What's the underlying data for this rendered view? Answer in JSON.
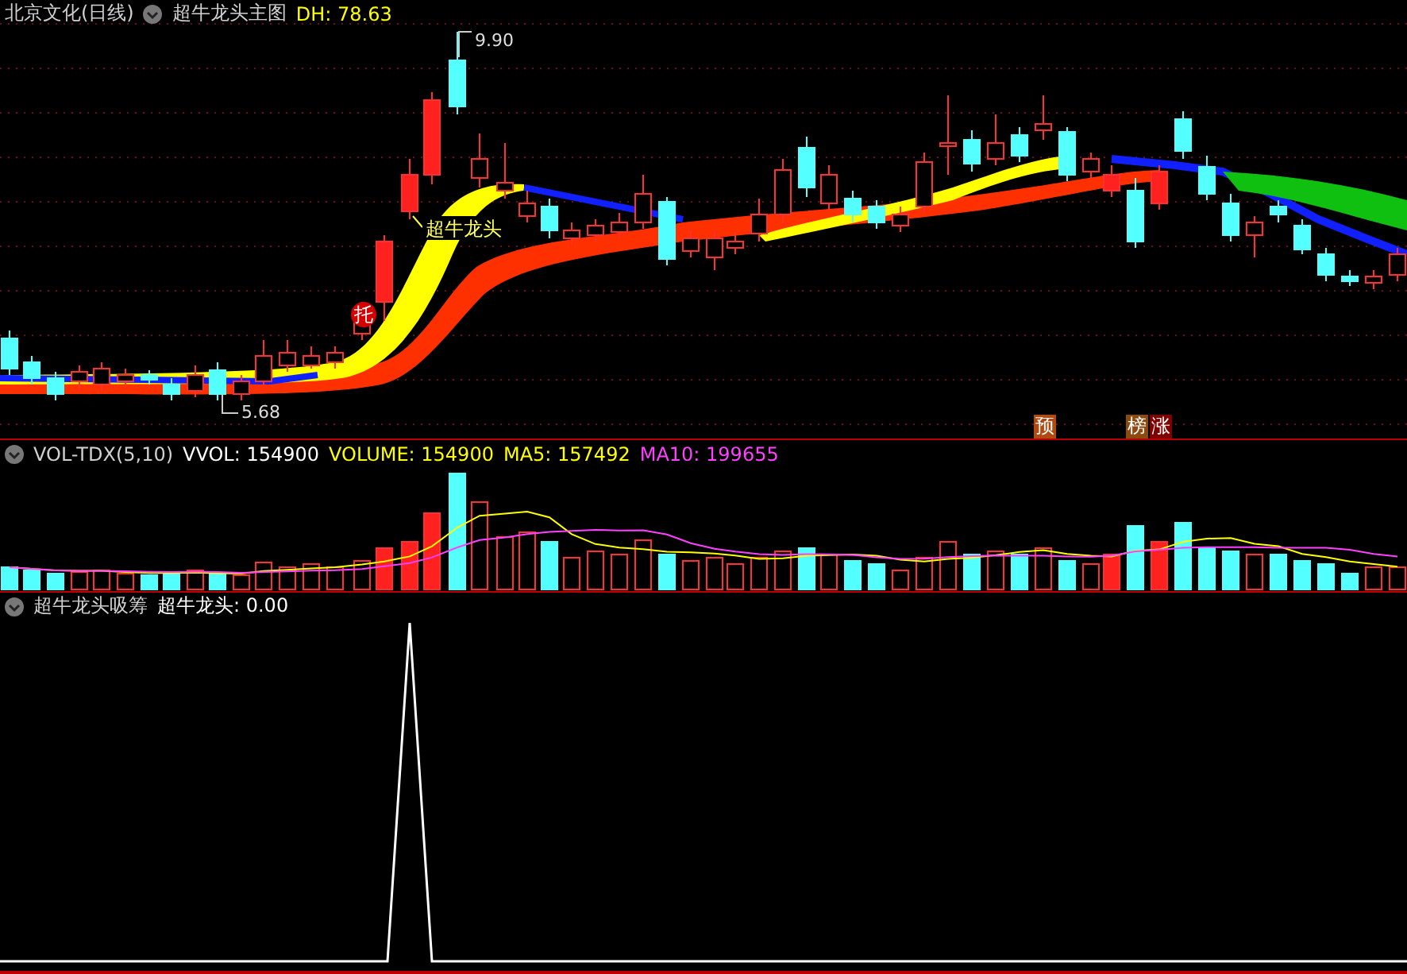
{
  "main_panel": {
    "stock": "北京文化(日线)",
    "indicator": "超牛龙头主图",
    "dh": "DH: 78.63",
    "high_label": "9.90",
    "low_label": "5.68",
    "signal_label": "超牛龙头",
    "badges": [
      {
        "text": "托",
        "color": "#d40000"
      },
      {
        "text": "预",
        "color": "#b04a10"
      },
      {
        "text": "榜",
        "color": "#8a4a10"
      },
      {
        "text": "涨",
        "color": "#800000"
      }
    ]
  },
  "volume_panel": {
    "name": "VOL-TDX(5,10)",
    "vvol": "VVOL: 154900",
    "volume": "VOLUME: 154900",
    "ma5": "MA5: 157492",
    "ma10": "MA10: 199655"
  },
  "indicator_panel": {
    "name": "超牛龙头吸筹",
    "value": "超牛龙头: 0.00"
  }
}
